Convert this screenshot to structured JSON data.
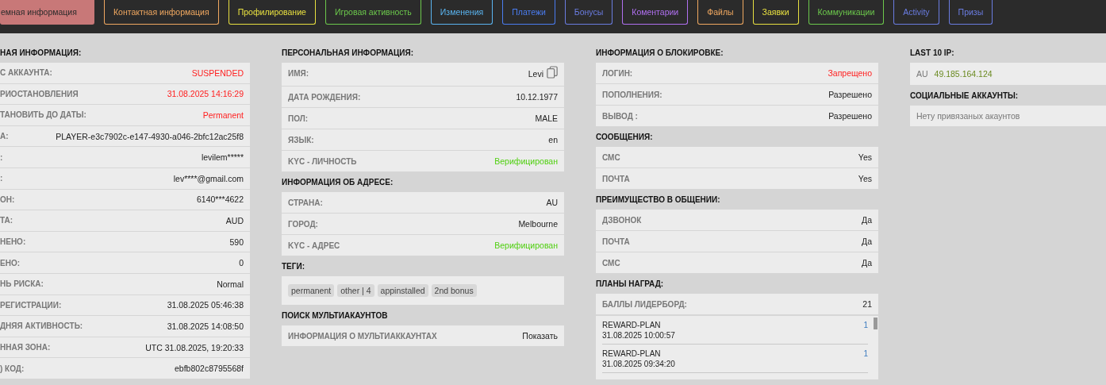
{
  "tabs": [
    {
      "label": "емная информация",
      "color": "#c87878",
      "selected": true
    },
    {
      "label": "Контактная информация",
      "color": "#f0a860",
      "selected": false
    },
    {
      "label": "Профилирование",
      "color": "#e8e040",
      "selected": false
    },
    {
      "label": "Игровая активность",
      "color": "#6cc84c",
      "selected": false
    },
    {
      "label": "Изменения",
      "color": "#5ab4f0",
      "selected": false
    },
    {
      "label": "Платежи",
      "color": "#4a7cf0",
      "selected": false
    },
    {
      "label": "Бонусы",
      "color": "#6a7ce0",
      "selected": false
    },
    {
      "label": "Коментарии",
      "color": "#b070f0",
      "selected": false
    },
    {
      "label": "Файлы",
      "color": "#f0a860",
      "selected": false
    },
    {
      "label": "Заявки",
      "color": "#e8e040",
      "selected": false
    },
    {
      "label": "Коммуникации",
      "color": "#6cc84c",
      "selected": false
    },
    {
      "label": "Activity",
      "color": "#6a7ce0",
      "selected": false
    },
    {
      "label": "Призы",
      "color": "#6a7ce0",
      "selected": false
    }
  ],
  "columns": [
    {
      "sections": [
        {
          "title": "НАЯ ИНФОРМАЦИЯ:",
          "kind": "rows",
          "rows": [
            {
              "label": "С АККАУНТА:",
              "value": "SUSPENDED",
              "color": "#ff2020"
            },
            {
              "label": "РИОСТАНОВЛЕНИЯ",
              "value": "31.08.2025 14:16:29",
              "color": "#ff2020"
            },
            {
              "label": "ТАНОВИТЬ ДО ДАТЫ:",
              "value": "Permanent",
              "color": "#ff2020"
            },
            {
              "label": "А:",
              "value": "PLAYER-e3c7902c-e147-4930-a046-2bfc12ac25f8"
            },
            {
              "label": ":",
              "value": "levilem*****"
            },
            {
              "label": ":",
              "value": "lev****@gmail.com"
            },
            {
              "label": "ОН:",
              "value": "6140***4622"
            },
            {
              "label": "ТА:",
              "value": "AUD"
            },
            {
              "label": "НЕНО:",
              "value": "590"
            },
            {
              "label": "ЕНО:",
              "value": "0"
            },
            {
              "label": "НЬ РИСКА:",
              "value": "Normal"
            },
            {
              "label": "РЕГИСТРАЦИИ:",
              "value": "31.08.2025 05:46:38"
            },
            {
              "label": "ДНЯЯ АКТИВНОСТЬ:",
              "value": "31.08.2025 14:08:50"
            },
            {
              "label": "ННАЯ ЗОНА:",
              "value": "UTC 31.08.2025, 19:20:33"
            },
            {
              "label": ") КОД:",
              "value": "ebfb802c8795568f"
            }
          ]
        }
      ]
    },
    {
      "sections": [
        {
          "title": "ПЕРСОНАЛЬНАЯ ИНФОРМАЦИЯ:",
          "kind": "rows",
          "rows": [
            {
              "label": "ИМЯ:",
              "value": "Levi",
              "copy": true
            },
            {
              "label": "ДАТА РОЖДЕНИЯ:",
              "value": "10.12.1977"
            },
            {
              "label": "ПОЛ:",
              "value": "MALE"
            },
            {
              "label": "ЯЗЫК:",
              "value": "en"
            },
            {
              "label": "KYC - ЛИЧНОСТЬ",
              "value": "Верифицирован",
              "color": "#50d010"
            }
          ]
        },
        {
          "title": "ИНФОРМАЦИЯ ОБ АДРЕСЕ:",
          "kind": "rows",
          "rows": [
            {
              "label": "СТРАНА:",
              "value": "AU"
            },
            {
              "label": "ГОРОД:",
              "value": "Melbourne"
            },
            {
              "label": "KYC - АДРЕС",
              "value": "Верифицирован",
              "color": "#50d010"
            }
          ]
        },
        {
          "title": "ТЕГИ:",
          "kind": "tags",
          "tags": [
            "permanent",
            "other | 4",
            "appinstalled",
            "2nd bonus"
          ]
        },
        {
          "title": "ПОИСК МУЛЬТИАКАУНТОВ",
          "kind": "rows",
          "rows": [
            {
              "label": "ИНФОРМАЦИЯ О МУЛЬТИАККАУНТАХ",
              "value": "Показать",
              "link": true
            }
          ]
        }
      ]
    },
    {
      "sections": [
        {
          "title": "ИНФОРМАЦИЯ О БЛОКИРОВКЕ:",
          "kind": "rows",
          "rows": [
            {
              "label": "ЛОГИН:",
              "value": "Запрещено",
              "color": "#ff2020"
            },
            {
              "label": "ПОПОЛНЕНИЯ:",
              "value": "Разрешено"
            },
            {
              "label": "ВЫВОД :",
              "value": "Разрешено"
            }
          ]
        },
        {
          "title": "СООБЩЕНИЯ:",
          "kind": "rows",
          "rows": [
            {
              "label": "СМС",
              "value": "Yes"
            },
            {
              "label": "ПОЧТА",
              "value": "Yes"
            }
          ]
        },
        {
          "title": "ПРЕИМУЩЕСТВО В ОБЩЕНИИ:",
          "kind": "rows",
          "rows": [
            {
              "label": "ДЗВОНОК",
              "value": "Да"
            },
            {
              "label": "ПОЧТА",
              "value": "Да"
            },
            {
              "label": "СМС",
              "value": "Да"
            }
          ]
        },
        {
          "title": "ПЛАНЫ НАГРАД:",
          "kind": "rewards",
          "rows": [
            {
              "label": "БАЛЛЫ ЛИДЕРБОРД:",
              "value": "21"
            }
          ],
          "items": [
            {
              "name": "REWARD-PLAN",
              "date": "31.08.2025 10:00:57",
              "count": "1"
            },
            {
              "name": "REWARD-PLAN",
              "date": "31.08.2025 09:34:20",
              "count": "1"
            }
          ]
        }
      ]
    },
    {
      "sections": [
        {
          "title": "LAST 10 IP:",
          "kind": "ip",
          "entries": [
            {
              "country": "AU",
              "ip": "49.185.164.124"
            }
          ]
        },
        {
          "title": "СОЦИАЛЬНЫЕ АККАУНТЫ:",
          "kind": "note",
          "text": "Нету привязаных акаунтов"
        }
      ]
    }
  ]
}
